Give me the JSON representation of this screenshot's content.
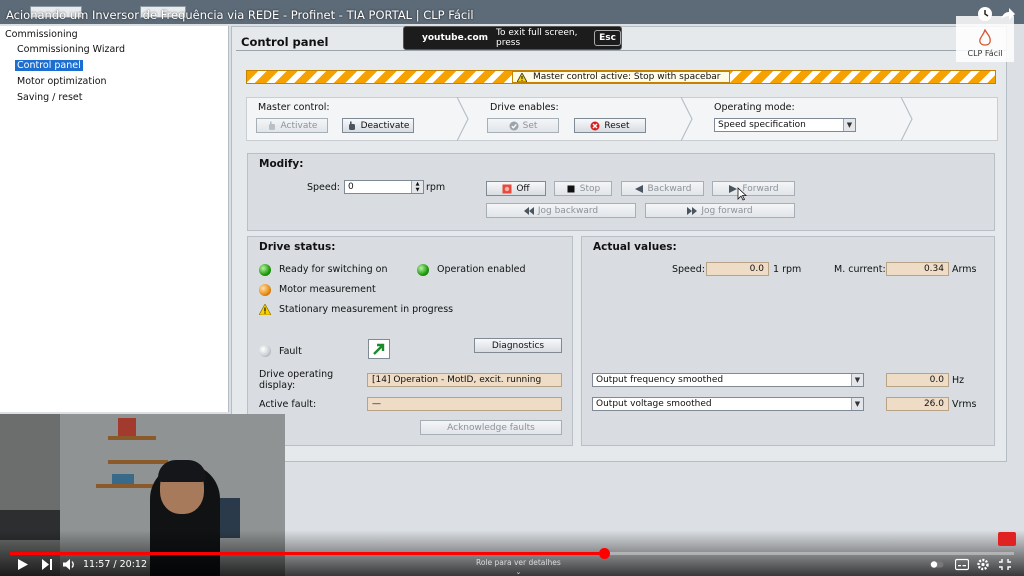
{
  "video": {
    "title": "Acionando um Inversor de Frequência via REDE - Profinet - TIA PORTAL | CLP Fácil",
    "fullscreen_site": "youtube.com",
    "fullscreen_hint": "To exit full screen, press",
    "fullscreen_key": "Esc",
    "channel_logo_text": "CLP Fácil",
    "time_current": "11:57",
    "time_separator": " / ",
    "time_total": "20:12",
    "progress_fraction": 0.592,
    "scroll_hint": "Role para ver detalhes"
  },
  "nav": {
    "root": "Commissioning",
    "items": [
      {
        "label": "Commissioning Wizard",
        "selected": false
      },
      {
        "label": "Control panel",
        "selected": true
      },
      {
        "label": "Motor optimization",
        "selected": false
      },
      {
        "label": "Saving / reset",
        "selected": false
      }
    ]
  },
  "panel": {
    "title": "Control panel",
    "warning": "Master control active: Stop with spacebar",
    "master_control": {
      "label": "Master control:",
      "activate": "Activate",
      "deactivate": "Deactivate"
    },
    "drive_enables": {
      "label": "Drive enables:",
      "set": "Set",
      "reset": "Reset"
    },
    "operating_mode": {
      "label": "Operating mode:",
      "value": "Speed specification"
    },
    "modify": {
      "title": "Modify:",
      "speed_label": "Speed:",
      "speed_value": "0",
      "speed_unit": "rpm",
      "off": "Off",
      "stop": "Stop",
      "backward": "Backward",
      "forward": "Forward",
      "jog_backward": "Jog backward",
      "jog_forward": "Jog forward"
    },
    "drive_status": {
      "title": "Drive status:",
      "ready": "Ready for switching on",
      "operation_enabled": "Operation enabled",
      "motor_measurement": "Motor measurement",
      "stationary": "Stationary measurement in progress",
      "fault": "Fault",
      "diagnostics": "Diagnostics",
      "op_display_label_1": "Drive operating",
      "op_display_label_2": "display:",
      "op_display_value": "[14] Operation - MotID, excit. running",
      "active_fault_label": "Active fault:",
      "active_fault_value": "—",
      "acknowledge": "Acknowledge faults"
    },
    "actual_values": {
      "title": "Actual values:",
      "speed_label": "Speed:",
      "speed_value": "0.0",
      "speed_unit": "1 rpm",
      "current_label": "M. current:",
      "current_value": "0.34",
      "current_unit": "Arms",
      "sel1": "Output frequency smoothed",
      "val1": "0.0",
      "unit1": "Hz",
      "sel2": "Output voltage smoothed",
      "val2": "26.0",
      "unit2": "Vrms"
    }
  },
  "colors": {
    "selection": "#1c6fd1",
    "warning_stripe": "#f5a100",
    "readonly_field": "#efdcc6",
    "progress": "#ff0000"
  }
}
